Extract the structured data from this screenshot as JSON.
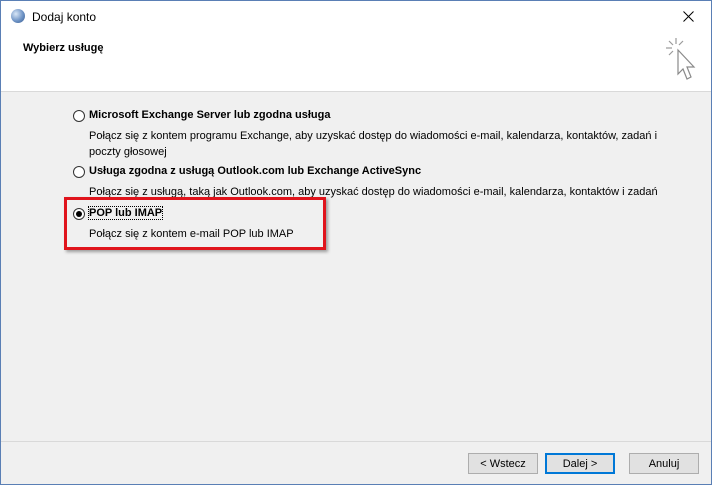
{
  "window": {
    "title": "Dodaj konto"
  },
  "header": {
    "title": "Wybierz usługę"
  },
  "options": [
    {
      "title": "Microsoft Exchange Server lub zgodna usługa",
      "description": "Połącz się z kontem programu Exchange, aby uzyskać dostęp do wiadomości e-mail, kalendarza, kontaktów, zadań i poczty głosowej",
      "selected": false
    },
    {
      "title": "Usługa zgodna z usługą Outlook.com lub Exchange ActiveSync",
      "description": "Połącz się z usługą, taką jak Outlook.com, aby uzyskać dostęp do wiadomości e-mail, kalendarza, kontaktów i zadań",
      "selected": false
    },
    {
      "title": "POP lub IMAP",
      "description": "Połącz się z kontem e-mail POP lub IMAP",
      "selected": true
    }
  ],
  "buttons": {
    "back": "< Wstecz",
    "next": "Dalej >",
    "cancel": "Anuluj"
  },
  "colors": {
    "highlight": "#e0141c",
    "window_border": "#5a7fb5",
    "default_button_border": "#0078d7"
  }
}
